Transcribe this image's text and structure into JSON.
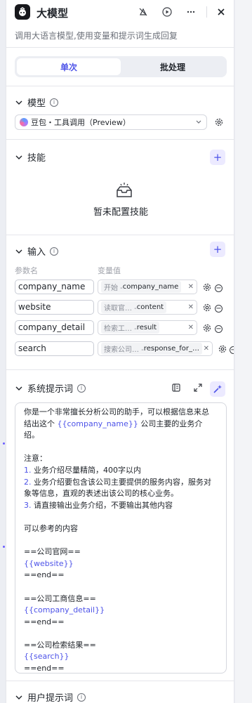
{
  "header": {
    "title": "大模型",
    "description": "调用大语言模型,使用变量和提示词生成回复"
  },
  "mode_tabs": [
    "单次",
    "批处理"
  ],
  "model_section": {
    "title": "模型",
    "selected_model": "豆包・工具调用（Preview）"
  },
  "skills_section": {
    "title": "技能",
    "empty_text": "暂未配置技能"
  },
  "input_section": {
    "title": "输入",
    "col_name": "参数名",
    "col_value": "变量值",
    "rows": [
      {
        "name": "company_name",
        "source": "开始 - ",
        "var": "company_name"
      },
      {
        "name": "website",
        "source": "读取官… - ",
        "var": "content"
      },
      {
        "name": "company_detail",
        "source": "检索工… - ",
        "var": "result"
      },
      {
        "name": "search",
        "source": "搜索公司… - ",
        "var": "response_for_…"
      }
    ]
  },
  "system_prompt": {
    "title": "系统提示词",
    "l1": "你是一个非常擅长分析公司的助手，可以根据信息来总",
    "l2a": "结出这个 ",
    "l2var": "{{company_name}}",
    "l2b": " 公司主要的业务介绍。",
    "l3": "注意：",
    "n1": "1.",
    "l4": " 业务介绍尽量精简，400字以内",
    "n2": "2.",
    "l5": " 业务介绍要包含该公司主要提供的服务内容，服务对",
    "l6": "象等信息，直观的表述出该公司的核心业务。",
    "n3": "3.",
    "l7": " 请直接输出业务介绍，不要输出其他内容",
    "l8": "可以参考的内容",
    "l9": "==公司官网==",
    "v1": "{{website}}",
    "e1": "==end==",
    "l10": "==公司工商信息==",
    "v2": "{{company_detail}}",
    "e2": "==end==",
    "l11": "==公司检索结果==",
    "v3": "{{search}}",
    "e3": "==end=="
  },
  "user_prompt": {
    "title": "用户提示词"
  },
  "colors": {
    "accent": "#4d53e8",
    "accent_bg": "#eceaff",
    "panel_bg": "#ffffff",
    "page_bg": "#eceef3"
  }
}
